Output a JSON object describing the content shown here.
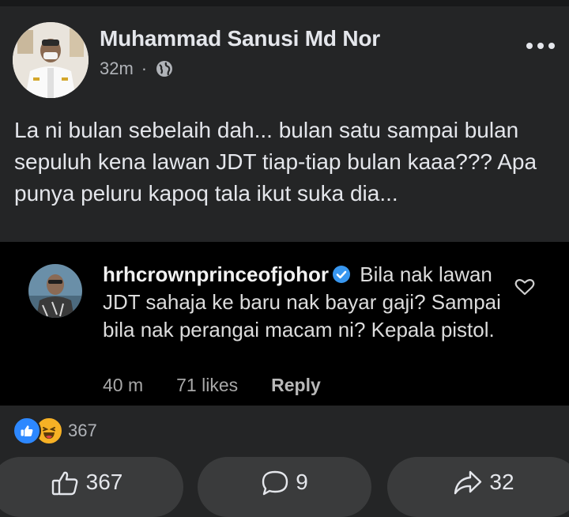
{
  "post": {
    "author": "Muhammad Sanusi Md Nor",
    "time": "32m",
    "separator": "·",
    "text": "La ni bulan sebelaih dah... bulan satu sampai bulan sepuluh kena lawan JDT tiap-tiap bulan kaaa??? Apa punya peluru kapoq tala ikut suka dia..."
  },
  "embedded_comment": {
    "username": "hrhcrownprinceofjohor",
    "text": "Bila nak lawan JDT sahaja ke baru nak bayar gaji? Sampai bila nak perangai macam ni? Kepala pistol.",
    "time": "40 m",
    "likes": "71 likes",
    "reply_label": "Reply"
  },
  "reactions": {
    "count": "367",
    "icons": [
      "like-icon",
      "haha-icon"
    ]
  },
  "actions": {
    "like_count": "367",
    "comment_count": "9",
    "share_count": "32"
  },
  "colors": {
    "background": "#242526",
    "accent": "#2d88ff",
    "haha": "#f7b125",
    "button": "#3a3b3c",
    "text": "#e4e6eb",
    "secondary_text": "#b0b3b8"
  }
}
